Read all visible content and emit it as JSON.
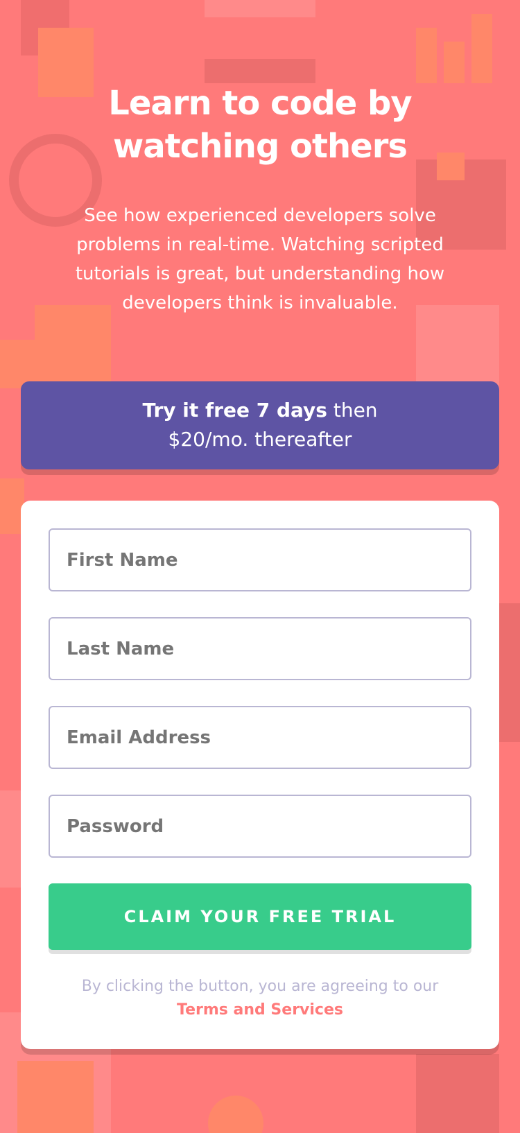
{
  "hero": {
    "title_line1": "Learn to code by",
    "title_line2": "watching others",
    "description": "See how experienced developers solve problems in real-time. Watching scripted tutorials is great, but understanding how developers think is invaluable."
  },
  "offer": {
    "bold": "Try it free 7 days",
    "rest_line1": " then",
    "line2": "$20/mo. thereafter"
  },
  "form": {
    "first_name_placeholder": "First Name",
    "last_name_placeholder": "Last Name",
    "email_placeholder": "Email Address",
    "password_placeholder": "Password",
    "submit_label": "CLAIM YOUR FREE TRIAL"
  },
  "legal": {
    "text": "By clicking the button, you are agreeing to our",
    "link": "Terms and Services"
  },
  "colors": {
    "background": "#ff7a7a",
    "offer_bg": "#5e54a4",
    "button": "#38cc8b",
    "field_border": "#b9b6d3",
    "legal_text": "#b9b6d3"
  }
}
